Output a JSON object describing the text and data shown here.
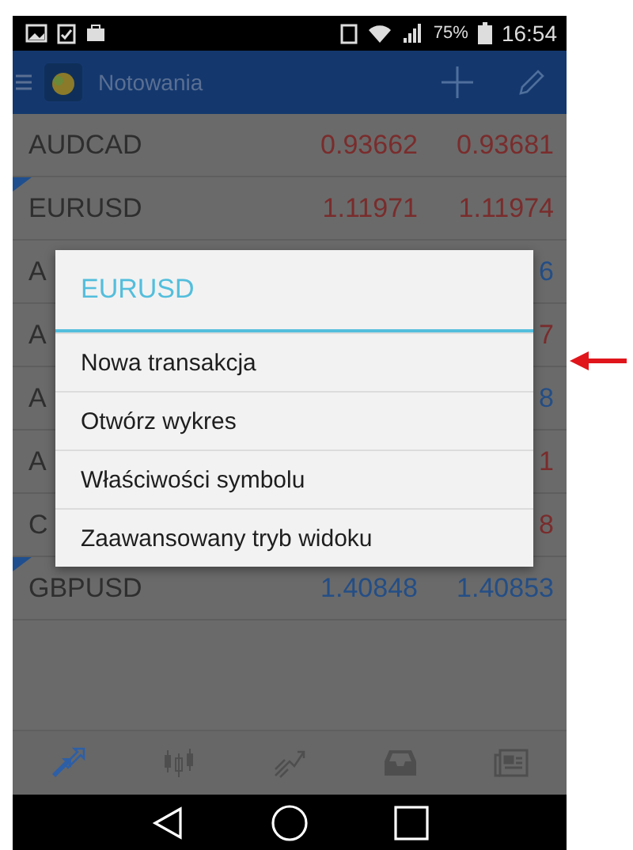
{
  "status_bar": {
    "battery": "75%",
    "time": "16:54"
  },
  "app_bar": {
    "title": "Notowania"
  },
  "quotes": [
    {
      "symbol": "AUDCAD",
      "bid": "0.93662",
      "ask": "0.93681",
      "color": "#7a2c2c",
      "flagged": false
    },
    {
      "symbol": "EURUSD",
      "bid": "1.11971",
      "ask": "1.11974",
      "color": "#7a2c2c",
      "flagged": true
    },
    {
      "symbol": "A",
      "ask": "6",
      "color": "#244e86",
      "flagged": false
    },
    {
      "symbol": "A",
      "ask": "7",
      "color": "#7a2c2c",
      "flagged": false
    },
    {
      "symbol": "A",
      "ask": "8",
      "color": "#244e86",
      "flagged": false
    },
    {
      "symbol": "A",
      "ask": "1",
      "color": "#7a2c2c",
      "flagged": false
    },
    {
      "symbol": "C",
      "ask": "8",
      "color": "#7a2c2c",
      "flagged": false
    },
    {
      "symbol": "GBPUSD",
      "bid": "1.40848",
      "ask": "1.40853",
      "color": "#244e86",
      "flagged": true
    }
  ],
  "dialog": {
    "title": "EURUSD",
    "items": [
      "Nowa transakcja",
      "Otwórz wykres",
      "Właściwości symbolu",
      "Zaawansowany tryb widoku"
    ]
  },
  "bottom_nav": [
    {
      "kind": "quotes",
      "selected": true
    },
    {
      "kind": "chart",
      "selected": false
    },
    {
      "kind": "trade",
      "selected": false
    },
    {
      "kind": "history",
      "selected": false
    },
    {
      "kind": "news",
      "selected": false
    }
  ]
}
